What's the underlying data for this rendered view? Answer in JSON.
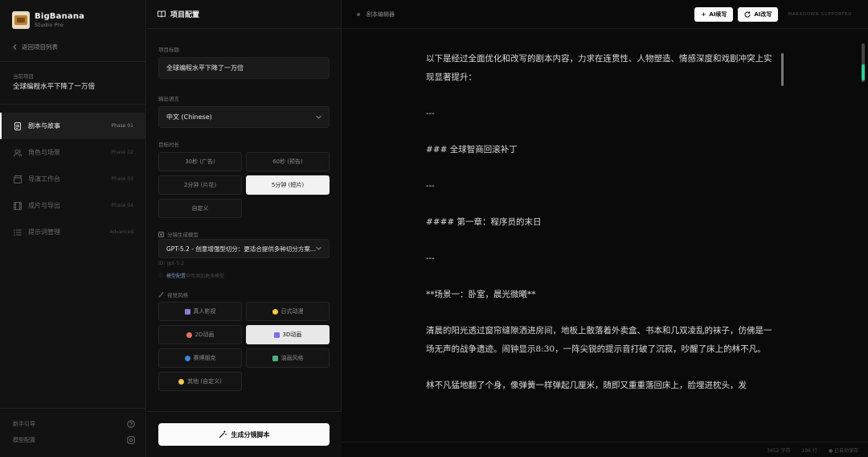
{
  "brand": {
    "name": "BigBanana",
    "subtitle": "Studio Pro"
  },
  "sidebar": {
    "back_label": "返回项目列表",
    "current_project_label": "当前项目",
    "current_project_name": "全球编程水平下降了一万倍",
    "items": [
      {
        "label": "剧本与故事",
        "phase": "Phase 01",
        "icon": "document-icon",
        "active": true
      },
      {
        "label": "角色与场景",
        "phase": "Phase 02",
        "icon": "users-icon",
        "active": false
      },
      {
        "label": "导演工作台",
        "phase": "Phase 03",
        "icon": "clapperboard-icon",
        "active": false
      },
      {
        "label": "成片与导出",
        "phase": "Phase 04",
        "icon": "film-icon",
        "active": false
      },
      {
        "label": "提示词管理",
        "phase": "Advanced",
        "icon": "list-icon",
        "active": false
      }
    ],
    "footer": [
      {
        "label": "新手引导",
        "icon": "help-icon"
      },
      {
        "label": "模型配置",
        "icon": "settings-icon"
      }
    ]
  },
  "config": {
    "title": "项目配置",
    "project_title_label": "项目标题",
    "project_title_value": "全球编程水平下降了一万倍",
    "output_language_label": "输出语言",
    "output_language_value": "中文 (Chinese)",
    "duration_label": "目标时长",
    "durations": [
      "30秒 (广告)",
      "60秒 (预告)",
      "2分钟 (片花)",
      "5分钟 (短片)",
      "自定义"
    ],
    "duration_selected": "5分钟 (短片)",
    "model_label": "分镜生成模型",
    "model_value": "GPT-5.2 - 创意增强型切分：更适合提供多种切分方案...",
    "model_id": "ID: gpt-5.2",
    "model_hint_link": "模型配置",
    "model_hint_rest": "中可添加更多模型",
    "style_label": "视觉风格",
    "styles": [
      {
        "label": "真人影视",
        "icon": "film-icon",
        "color": "#8a7cd6"
      },
      {
        "label": "日式动漫",
        "icon": "sparkle-icon",
        "color": "#f2c94c"
      },
      {
        "label": "2D动画",
        "icon": "palette-icon",
        "color": "#e07a5f"
      },
      {
        "label": "3D动画",
        "icon": "cube-icon",
        "color": "#7b6ee6"
      },
      {
        "label": "赛博朋克",
        "icon": "globe-icon",
        "color": "#3a86d9"
      },
      {
        "label": "油画风格",
        "icon": "painting-icon",
        "color": "#4caf7a"
      },
      {
        "label": "其他 (自定义)",
        "icon": "star-icon",
        "color": "#f2c94c"
      }
    ],
    "style_selected": "3D动画",
    "generate_label": "生成分镜脚本"
  },
  "editor": {
    "title": "剧本编辑器",
    "ai_continue": "AI续写",
    "ai_rewrite": "AI改写",
    "markdown_tag": "MARKDOWN SUPPORTED",
    "paragraphs": [
      "以下是经过全面优化和改写的剧本内容，力求在连贯性、人物塑造、情感深度和戏剧冲突上实现显著提升：",
      "---",
      "### 全球智商回滚补丁",
      "---",
      "#### 第一章：程序员的末日",
      "---",
      "**场景一：卧室，晨光微曦**",
      "清晨的阳光透过窗帘缝隙洒进房间，地板上散落着外卖盒、书本和几双凌乱的袜子，仿佛是一场无声的战争遗迹。闹钟显示8:30，一阵尖锐的提示音打破了沉寂，吵醒了床上的林不凡。",
      "林不凡猛地翻了个身，像弹簧一样弹起几厘米，随即又重重落回床上，脸埋进枕头，发"
    ],
    "footer": {
      "chars": "3652 字符",
      "lines": "196 行",
      "autosave": "已自动保存"
    }
  },
  "colors": {
    "accent": "#2bd19a",
    "active_bg": "#1e1e1e",
    "primary_button": "#fafafa"
  }
}
